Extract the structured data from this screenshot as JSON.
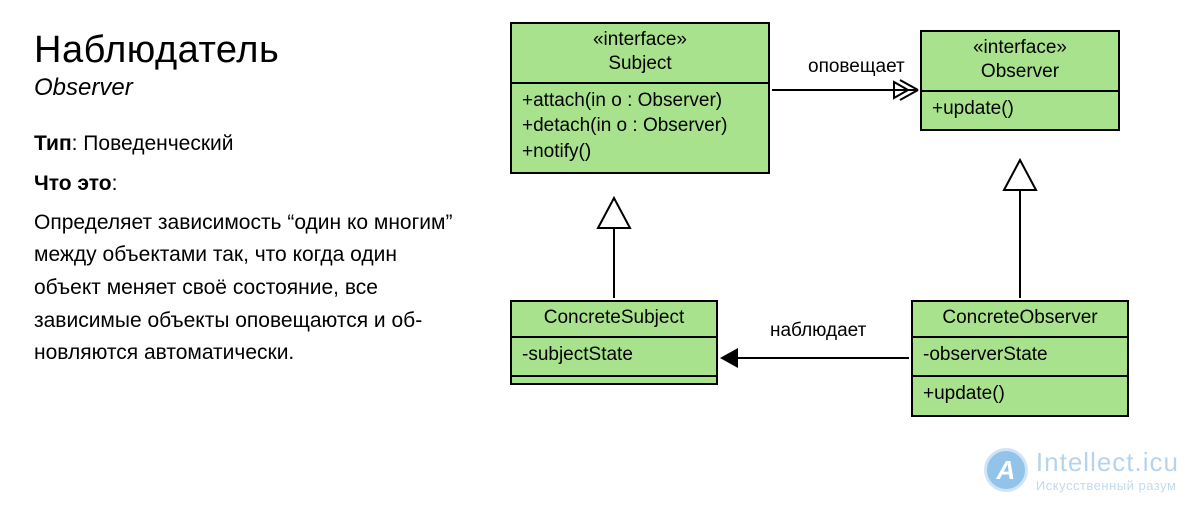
{
  "text": {
    "title": "Наблюдатель",
    "subtitle": "Observer",
    "type_label": "Тип",
    "type_value": "Поведенческий",
    "what_label": "Что это",
    "description": "Определяет зависимость “один ко многим” между объектами так, что когда один объект меняет своё состояние, все зависимые объекты оповещаются и об­новляются автоматически."
  },
  "diagram": {
    "subject": {
      "stereotype": "«interface»",
      "name": "Subject",
      "methods": [
        "+attach(in o : Observer)",
        "+detach(in o : Observer)",
        "+notify()"
      ]
    },
    "observer": {
      "stereotype": "«interface»",
      "name": "Observer",
      "methods": [
        "+update()"
      ]
    },
    "concreteSubject": {
      "name": "ConcreteSubject",
      "attrs": [
        "-subjectState"
      ]
    },
    "concreteObserver": {
      "name": "ConcreteObserver",
      "attrs": [
        "-observerState"
      ],
      "methods": [
        "+update()"
      ]
    },
    "labels": {
      "notifies": "оповещает",
      "observes": "наблюдает"
    }
  },
  "watermark": {
    "brand": "Intellect.icu",
    "tagline": "Искусственный разум"
  }
}
